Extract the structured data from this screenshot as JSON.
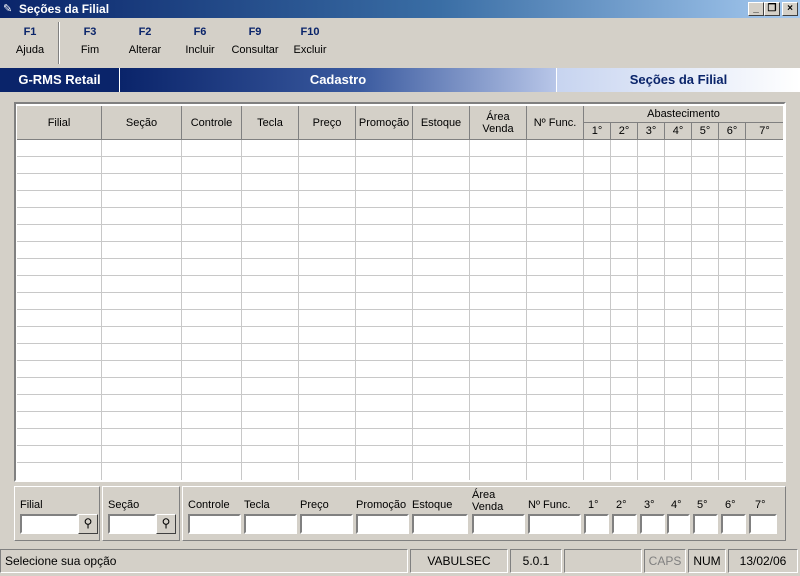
{
  "window": {
    "title": "Seções da Filial"
  },
  "toolbar": [
    {
      "key": "F1",
      "label": "Ajuda"
    },
    {
      "key": "F3",
      "label": "Fim"
    },
    {
      "key": "F2",
      "label": "Alterar"
    },
    {
      "key": "F6",
      "label": "Incluir"
    },
    {
      "key": "F9",
      "label": "Consultar"
    },
    {
      "key": "F10",
      "label": "Excluir"
    }
  ],
  "header": {
    "app": "G-RMS Retail",
    "module": "Cadastro",
    "screen": "Seções da Filial"
  },
  "grid": {
    "columns": [
      "Filial",
      "Seção",
      "Controle",
      "Tecla",
      "Preço",
      "Promoção",
      "Estoque",
      "Área Venda",
      "Nº Func."
    ],
    "group": "Abastecimento",
    "subcolumns": [
      "1°",
      "2°",
      "3°",
      "4°",
      "5°",
      "6°",
      "7°"
    ],
    "rows": []
  },
  "filters": {
    "filial_label": "Filial",
    "secao_label": "Seção",
    "fields": [
      "Controle",
      "Tecla",
      "Preço",
      "Promoção",
      "Estoque",
      "Área Venda",
      "Nº Func.",
      "1°",
      "2°",
      "3°",
      "4°",
      "5°",
      "6°",
      "7°"
    ]
  },
  "statusbar": {
    "message": "Selecione sua opção",
    "program": "VABULSEC",
    "version": "5.0.1",
    "caps": "CAPS",
    "num": "NUM",
    "date": "13/02/06"
  },
  "icons": {
    "title": "feather-icon",
    "lookup": "binoculars-icon"
  },
  "colors": {
    "titlebar": "#0a246a",
    "toolbar_key": "#0a246a",
    "face": "#d4d0c8"
  }
}
